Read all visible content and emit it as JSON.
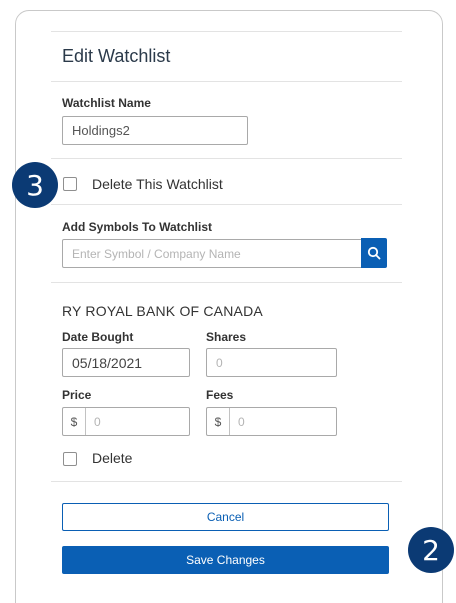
{
  "header": {
    "title": "Edit Watchlist"
  },
  "watchlist_name": {
    "label": "Watchlist Name",
    "value": "Holdings2"
  },
  "delete_watchlist": {
    "label": "Delete This Watchlist",
    "checked": false
  },
  "add_symbols": {
    "label": "Add Symbols To Watchlist",
    "placeholder": "Enter Symbol / Company Name"
  },
  "holding": {
    "title": "RY ROYAL BANK OF CANADA",
    "date_label": "Date Bought",
    "date_value": "05/18/2021",
    "shares_label": "Shares",
    "shares_value": "0",
    "price_label": "Price",
    "price_prefix": "$",
    "price_value": "0",
    "fees_label": "Fees",
    "fees_prefix": "$",
    "fees_value": "0",
    "delete_label": "Delete"
  },
  "buttons": {
    "cancel": "Cancel",
    "save": "Save Changes"
  },
  "badges": {
    "step_3": "3",
    "step_2": "2"
  },
  "colors": {
    "primary": "#0a5fb4",
    "badge": "#0b3a74"
  }
}
